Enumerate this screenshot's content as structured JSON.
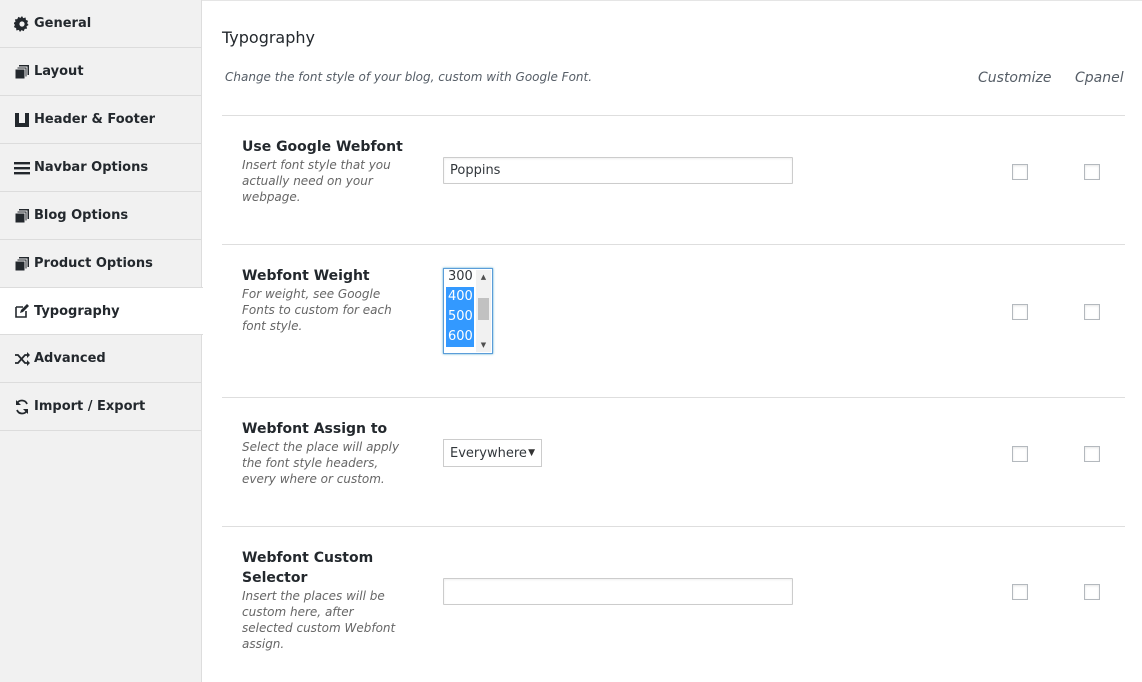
{
  "sidebar": {
    "items": [
      {
        "label": "General",
        "icon": "gear-icon"
      },
      {
        "label": "Layout",
        "icon": "layers-icon"
      },
      {
        "label": "Header & Footer",
        "icon": "header-footer-icon"
      },
      {
        "label": "Navbar Options",
        "icon": "menu-icon"
      },
      {
        "label": "Blog Options",
        "icon": "layers-icon"
      },
      {
        "label": "Product Options",
        "icon": "layers-icon"
      },
      {
        "label": "Typography",
        "icon": "edit-icon",
        "active": true
      },
      {
        "label": "Advanced",
        "icon": "shuffle-icon"
      },
      {
        "label": "Import / Export",
        "icon": "sync-icon"
      }
    ]
  },
  "main": {
    "title": "Typography",
    "description": "Change the font style of your blog, custom with Google Font.",
    "columns": {
      "customize": "Customize",
      "cpanel": "Cpanel"
    },
    "rows": [
      {
        "title": "Use Google Webfont",
        "help": "Insert font style that you actually need on your webpage.",
        "value": "Poppins"
      },
      {
        "title": "Webfont Weight",
        "help": "For weight, see Google Fonts to custom for each font style.",
        "options": [
          "300",
          "400",
          "500",
          "600"
        ],
        "selected": [
          "400",
          "500",
          "600"
        ]
      },
      {
        "title": "Webfont Assign to",
        "help": "Select the place will apply the font style headers, every where or custom.",
        "value": "Everywhere"
      },
      {
        "title": "Webfont Custom Selector",
        "help": "Insert the places will be custom here, after selected custom Webfont assign.",
        "value": ""
      }
    ]
  },
  "colors": {
    "selection": "#3399ff",
    "focus_border": "#5b9dd9",
    "sidebar_bg": "#f1f1f1"
  }
}
